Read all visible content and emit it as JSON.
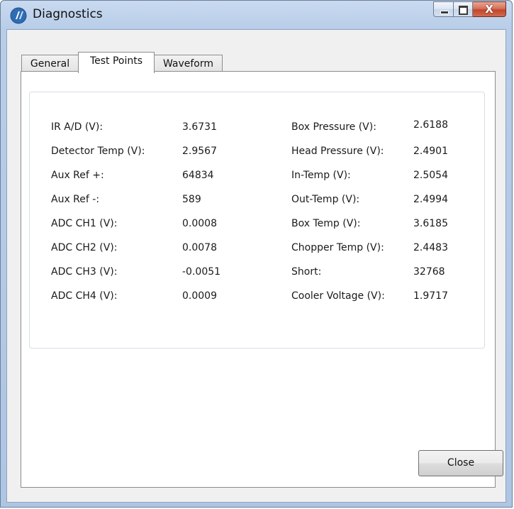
{
  "window": {
    "title": "Diagnostics",
    "close_glyph": "X"
  },
  "tabs": [
    {
      "label": "General"
    },
    {
      "label": "Test Points"
    },
    {
      "label": "Waveform"
    }
  ],
  "active_tab": "Test Points",
  "left_column": [
    {
      "label": "IR A/D (V):",
      "value": "3.6731"
    },
    {
      "label": "Detector Temp (V):",
      "value": "2.9567"
    },
    {
      "label": "Aux Ref +:",
      "value": "64834"
    },
    {
      "label": "Aux Ref -:",
      "value": "589"
    },
    {
      "label": "ADC CH1 (V):",
      "value": "0.0008"
    },
    {
      "label": "ADC CH2 (V):",
      "value": "0.0078"
    },
    {
      "label": "ADC CH3 (V):",
      "value": "-0.0051"
    },
    {
      "label": "ADC CH4 (V):",
      "value": "0.0009"
    }
  ],
  "right_column": [
    {
      "label": "Box Pressure (V):",
      "value": "2.6188"
    },
    {
      "label": "Head Pressure (V):",
      "value": "2.4901"
    },
    {
      "label": "In-Temp (V):",
      "value": "2.5054"
    },
    {
      "label": "Out-Temp (V):",
      "value": "2.4994"
    },
    {
      "label": "Box Temp (V):",
      "value": "3.6185"
    },
    {
      "label": "Chopper Temp (V):",
      "value": "2.4483"
    },
    {
      "label": "Short:",
      "value": "32768"
    },
    {
      "label": "Cooler Voltage (V):",
      "value": "1.9717"
    }
  ],
  "footer": {
    "close_label": "Close"
  }
}
